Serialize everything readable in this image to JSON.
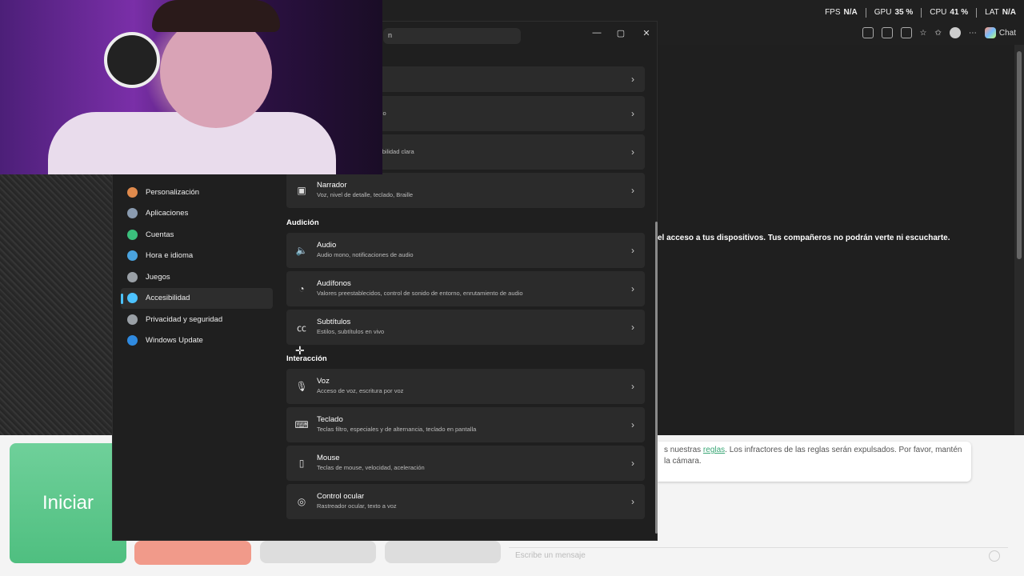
{
  "stats": {
    "fps_label": "FPS",
    "fps": "N/A",
    "gpu_label": "GPU",
    "gpu": "35 %",
    "cpu_label": "CPU",
    "cpu": "41 %",
    "lat_label": "LAT",
    "lat": "N/A"
  },
  "browser": {
    "chat_label": "Chat",
    "notice": "el acceso a tus dispositivos. Tus compañeros no podrán verte ni escucharte."
  },
  "settings": {
    "search_placeholder": "n",
    "nav": [
      {
        "label": "Personalización",
        "icon": "brush-icon",
        "color": "#e08a4c"
      },
      {
        "label": "Aplicaciones",
        "icon": "apps-icon",
        "color": "#8a9bb0"
      },
      {
        "label": "Cuentas",
        "icon": "account-icon",
        "color": "#3bbf7c"
      },
      {
        "label": "Hora e idioma",
        "icon": "globe-icon",
        "color": "#4aa3df"
      },
      {
        "label": "Juegos",
        "icon": "gamepad-icon",
        "color": "#9aa0a6"
      },
      {
        "label": "Accesibilidad",
        "icon": "accessibility-icon",
        "color": "#4cc2ff"
      },
      {
        "label": "Privacidad y seguridad",
        "icon": "shield-icon",
        "color": "#9aa0a6"
      },
      {
        "label": "Windows Update",
        "icon": "update-icon",
        "color": "#2f8ae0"
      }
    ],
    "cards_top": [
      {
        "title": "",
        "subtitle": "emento de zoom"
      },
      {
        "title": "",
        "subtitle": "escala de grises, invertido"
      },
      {
        "title": "",
        "subtitle": "ficiencias visuales, sensibilidad clara"
      },
      {
        "title": "Narrador",
        "subtitle": "Voz, nivel de detalle, teclado, Braille",
        "icon": "narrator-icon"
      }
    ],
    "section_audicion": "Audición",
    "cards_audicion": [
      {
        "title": "Audio",
        "subtitle": "Audio mono, notificaciones de audio",
        "icon": "speaker-icon"
      },
      {
        "title": "Audífonos",
        "subtitle": "Valores preestablecidos, control de sonido de entorno, enrutamiento de audio",
        "icon": "hearing-icon"
      },
      {
        "title": "Subtítulos",
        "subtitle": "Estilos, subtítulos en vivo",
        "icon": "captions-icon"
      }
    ],
    "section_interaccion": "Interacción",
    "cards_interaccion": [
      {
        "title": "Voz",
        "subtitle": "Acceso de voz, escritura por voz",
        "icon": "microphone-icon"
      },
      {
        "title": "Teclado",
        "subtitle": "Teclas filtro, especiales y de alternancia, teclado en pantalla",
        "icon": "keyboard-icon"
      },
      {
        "title": "Mouse",
        "subtitle": "Teclas de mouse, velocidad, aceleración",
        "icon": "mouse-icon"
      },
      {
        "title": "Control ocular",
        "subtitle": "Rastreador ocular, texto a voz",
        "icon": "eye-control-icon"
      }
    ]
  },
  "app": {
    "start_label": "Iniciar",
    "rules_pre": "s nuestras ",
    "rules_link": "reglas",
    "rules_post": ". Los infractores de las reglas serán expulsados. Por favor, mantén",
    "rules_line2": "la cámara.",
    "message_placeholder": "Escribe un mensaje"
  }
}
